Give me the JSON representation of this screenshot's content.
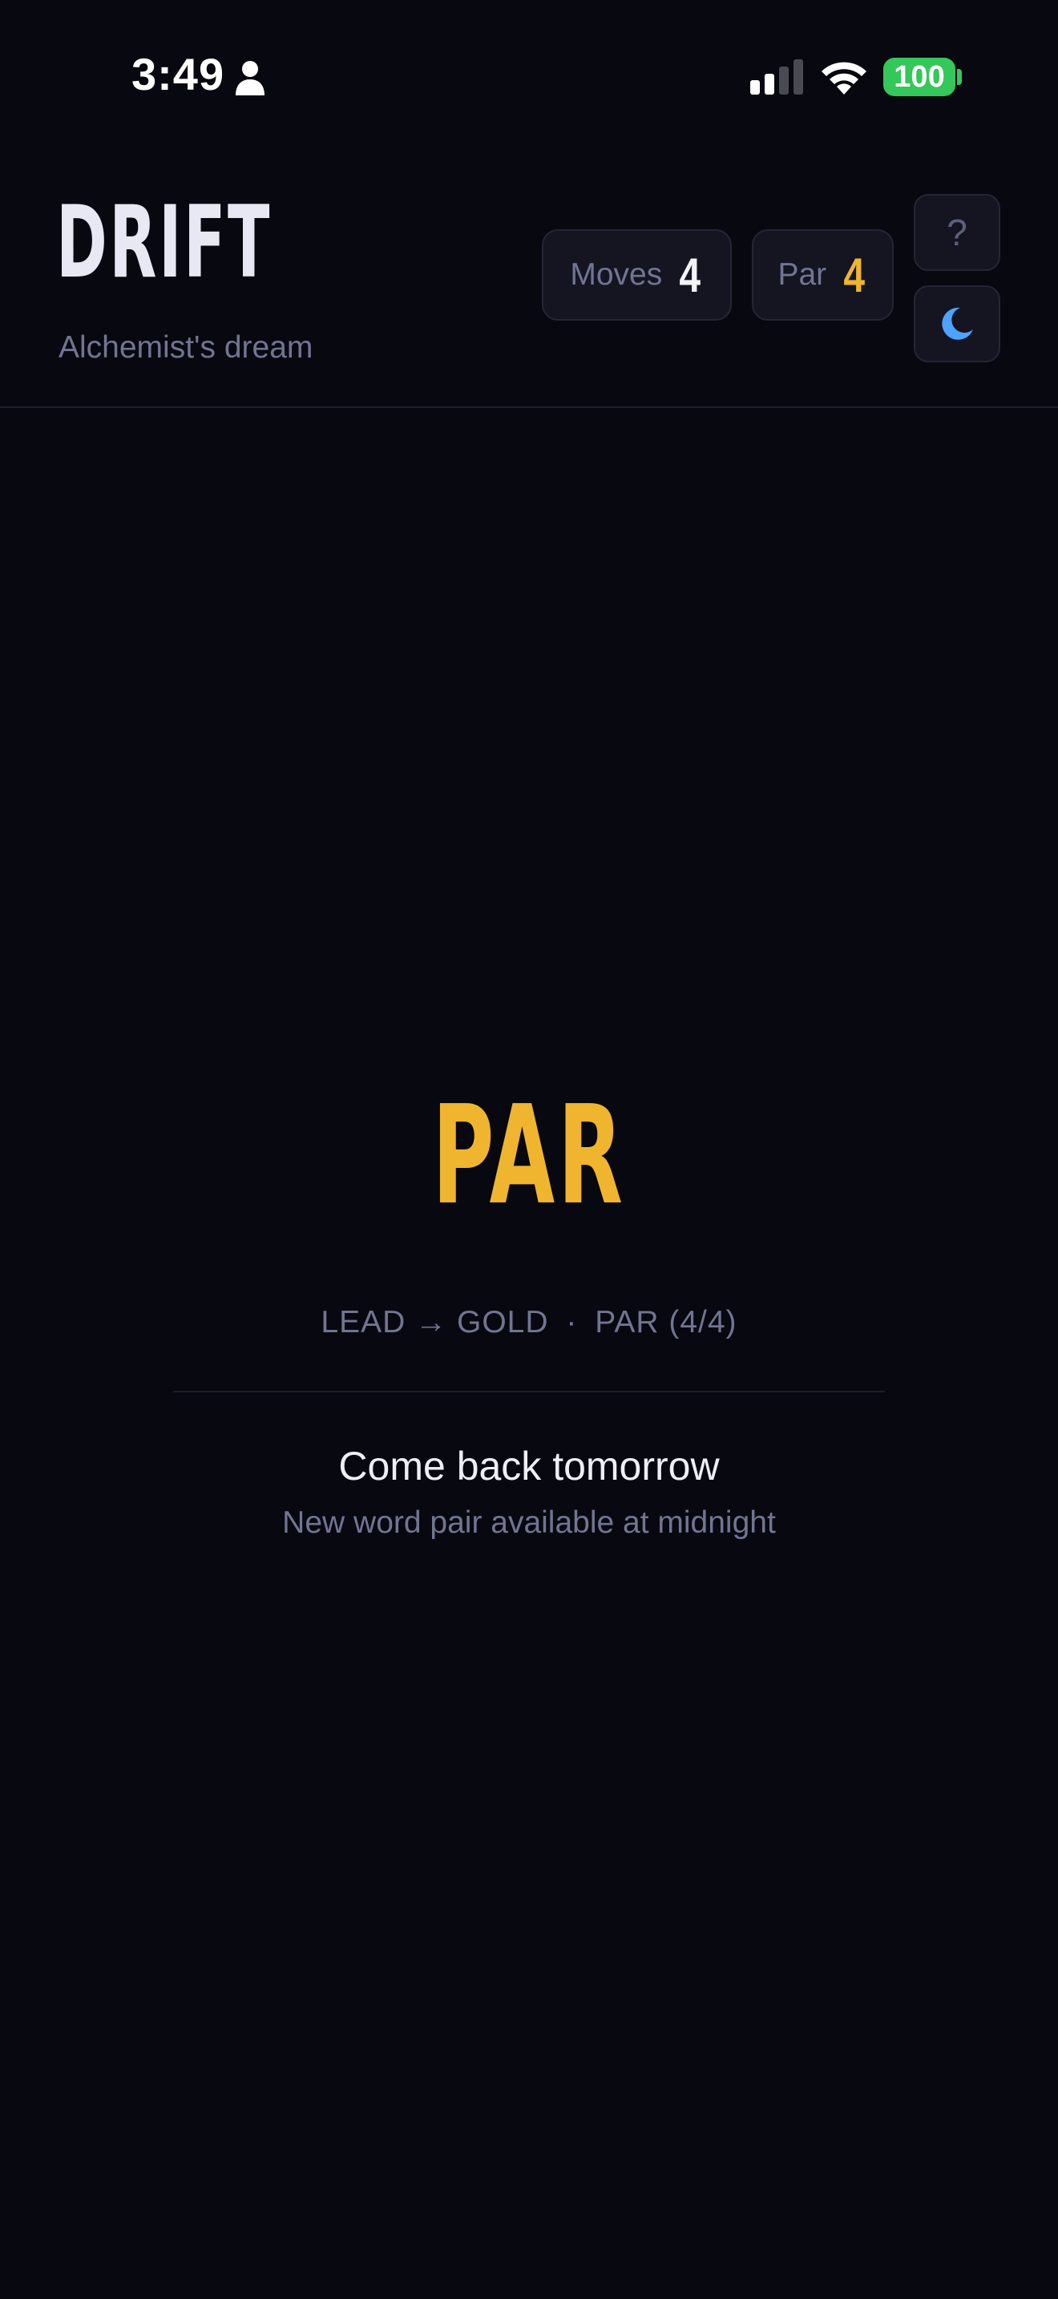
{
  "status_bar": {
    "time": "3:49",
    "battery_level": "100",
    "icons": [
      "person-icon",
      "cellular-signal-icon",
      "wifi-icon",
      "battery-icon"
    ],
    "colors": {
      "battery": "#34c759"
    }
  },
  "header": {
    "title": "DRIFT",
    "subtitle": "Alchemist's dream",
    "moves": {
      "label": "Moves",
      "value": "4"
    },
    "par": {
      "label": "Par",
      "value": "4"
    },
    "help_button": {
      "glyph": "?",
      "icon": "help-icon"
    },
    "theme_button": {
      "icon": "moon-icon"
    }
  },
  "result": {
    "rating": "PAR",
    "start_word": "LEAD",
    "arrow": "→",
    "end_word": "GOLD",
    "separator": "·",
    "rating_small": "PAR",
    "score": "(4/4)",
    "come_back": "Come back tomorrow",
    "next_note": "New word pair available at midnight"
  },
  "colors": {
    "background": "#080810",
    "accent_gold": "#f0b52e",
    "muted_text": "#717592",
    "moon_blue": "#4da3ff"
  }
}
